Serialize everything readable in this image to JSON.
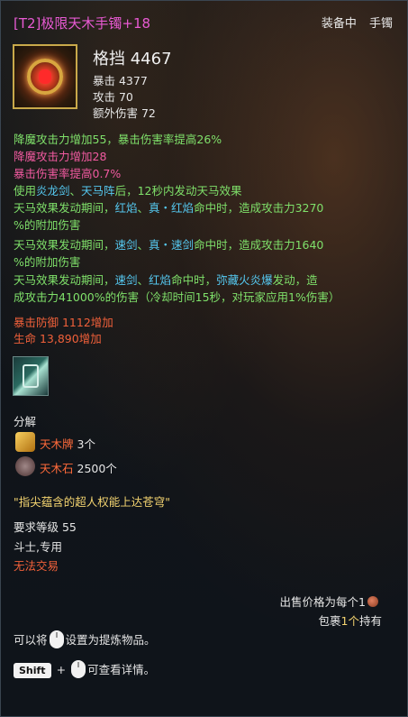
{
  "header": {
    "title": "[T2]极限天木手镯+18",
    "equipped": "装备中",
    "slot": "手镯"
  },
  "item": {
    "icon": "bracelet-icon",
    "main_stat": "格挡 4467",
    "sub_stats": [
      "暴击 4377",
      "攻击 70",
      "额外伤害 72"
    ]
  },
  "effects": {
    "line1": "降魔攻击力增加55，暴击伤害率提高26%",
    "line2": "降魔攻击力增加28",
    "line3": "暴击伤害率提高0.7%",
    "set_use_a": "使用",
    "set_skill1": "炎龙剑",
    "set_sep1": "、",
    "set_skill2": "天马阵",
    "set_use_b": "后，12秒内发动天马效果",
    "e1_a": "天马效果发动期间，",
    "e1_s1": "红焰",
    "e1_sep": "、",
    "e1_s2": "真・红焰",
    "e1_b": "命中时，造成攻击力3270",
    "e1_c": "%的附加伤害",
    "e2_a": "天马效果发动期间，",
    "e2_s1": "速剑",
    "e2_sep": "、",
    "e2_s2": "真・速剑",
    "e2_b": "命中时，造成攻击力1640",
    "e2_c": "%的附加伤害",
    "e3_a": "天马效果发动期间，",
    "e3_s1": "速剑",
    "e3_sep": "、",
    "e3_s2": "红焰",
    "e3_b": "命中时，",
    "e3_s3": "弥藏火炎爆",
    "e3_c": "发动，造",
    "e3_d": "成攻击力41000%的伤害（冷却时间15秒，对玩家应用1%伤害）"
  },
  "bonus": {
    "line1": "暴击防御 1112增加",
    "line2": "生命 13,890增加"
  },
  "slot": {
    "icon": "soul-slot-icon"
  },
  "disassemble": {
    "label": "分解",
    "materials": [
      {
        "icon": "tianmu-token-icon",
        "name": "天木牌",
        "count": "3个"
      },
      {
        "icon": "tianmu-stone-icon",
        "name": "天木石",
        "count": "2500个"
      }
    ]
  },
  "flavor": "\"指尖蕴含的超人权能上达苍穹\"",
  "requirements": {
    "level": "要求等级 55",
    "class": "斗士,专用",
    "trade": "无法交易"
  },
  "footer": {
    "sell_price": "出售价格为每个1",
    "bag_a": "包裹",
    "bag_count": "1个",
    "bag_b": "持有",
    "refine_a": "可以将",
    "refine_b": "设置为提炼物品。",
    "shift_key": "Shift",
    "plus": "+",
    "detail": "可查看详情。"
  },
  "colors": {
    "title": "#e85ad3",
    "effect_green": "#7fe06a",
    "effect_pink": "#f15aa0",
    "skill_cyan": "#55c8f0",
    "skill_orange": "#ff6a3a",
    "bonus_red": "#f0603a",
    "flavor_yellow": "#f3d370"
  }
}
